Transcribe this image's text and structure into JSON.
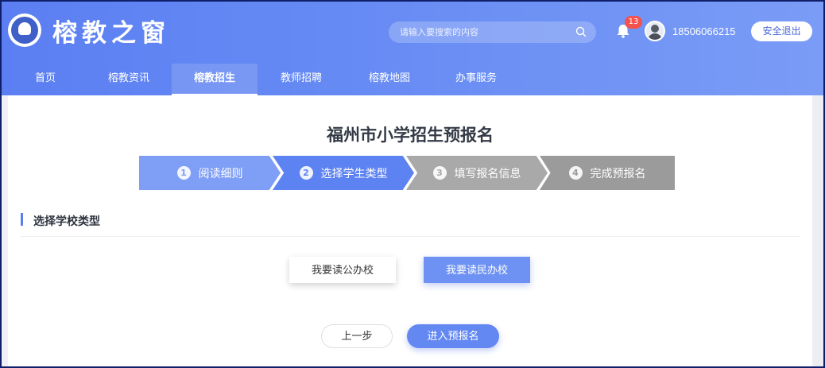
{
  "header": {
    "site_title": "榕教之窗",
    "search_placeholder": "请输入要搜索的内容",
    "notification_count": "13",
    "user_phone": "18506066215",
    "logout_label": "安全退出"
  },
  "nav": {
    "items": [
      "首页",
      "榕教资讯",
      "榕教招生",
      "教师招聘",
      "榕教地图",
      "办事服务"
    ],
    "active_index": 2
  },
  "main": {
    "page_title": "福州市小学招生预报名",
    "steps": [
      {
        "number": "1",
        "label": "阅读细则",
        "state": "done"
      },
      {
        "number": "2",
        "label": "选择学生类型",
        "state": "current"
      },
      {
        "number": "3",
        "label": "填写报名信息",
        "state": "todo"
      },
      {
        "number": "4",
        "label": "完成预报名",
        "state": "todo"
      }
    ],
    "section_title": "选择学校类型",
    "choice_public": "我要读公办校",
    "choice_private": "我要读民办校",
    "prev_label": "上一步",
    "next_label": "进入预报名"
  },
  "colors": {
    "header_blue": "#5b7ff2",
    "step_active": "#5d82f1",
    "step_inactive": "#a9a9a9",
    "badge_red": "#f4524d"
  }
}
